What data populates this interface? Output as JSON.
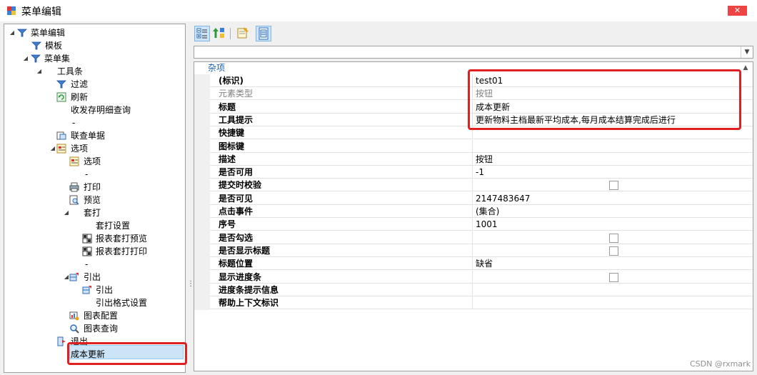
{
  "window": {
    "title": "菜单编辑"
  },
  "tree": {
    "items": [
      {
        "label": "菜单编辑",
        "icon": "filter-icon",
        "arrow": "▲"
      },
      {
        "label": "模板",
        "icon": "filter-icon",
        "arrow": ""
      },
      {
        "label": "菜单集",
        "icon": "filter-icon",
        "arrow": "▲"
      },
      {
        "label": "工具条",
        "icon": "",
        "arrow": "▲"
      },
      {
        "label": "过滤",
        "icon": "filter-icon",
        "arrow": ""
      },
      {
        "label": "刷新",
        "icon": "refresh-icon",
        "arrow": ""
      },
      {
        "label": "收发存明细查询",
        "icon": "",
        "arrow": ""
      },
      {
        "label": "-",
        "icon": "",
        "arrow": ""
      },
      {
        "label": "联查单据",
        "icon": "link-doc-icon",
        "arrow": ""
      },
      {
        "label": "选项",
        "icon": "options-icon",
        "arrow": "▲"
      },
      {
        "label": "选项",
        "icon": "options-icon",
        "arrow": ""
      },
      {
        "label": "-",
        "icon": "",
        "arrow": ""
      },
      {
        "label": "打印",
        "icon": "printer-icon",
        "arrow": ""
      },
      {
        "label": "预览",
        "icon": "preview-icon",
        "arrow": ""
      },
      {
        "label": "套打",
        "icon": "",
        "arrow": "▲"
      },
      {
        "label": "套打设置",
        "icon": "",
        "arrow": ""
      },
      {
        "label": "报表套打预览",
        "icon": "grid-report-icon",
        "arrow": ""
      },
      {
        "label": "报表套打打印",
        "icon": "grid-report-icon",
        "arrow": ""
      },
      {
        "label": "-",
        "icon": "",
        "arrow": ""
      },
      {
        "label": "引出",
        "icon": "export-icon",
        "arrow": "▲"
      },
      {
        "label": "引出",
        "icon": "export-icon",
        "arrow": ""
      },
      {
        "label": "引出格式设置",
        "icon": "",
        "arrow": ""
      },
      {
        "label": "图表配置",
        "icon": "chart-config-icon",
        "arrow": ""
      },
      {
        "label": "图表查询",
        "icon": "magnifier-icon",
        "arrow": ""
      },
      {
        "label": "退出",
        "icon": "exit-icon",
        "arrow": ""
      },
      {
        "label": "成本更新",
        "icon": "",
        "arrow": ""
      }
    ]
  },
  "toolbar": {
    "buttons": [
      {
        "name": "categorized-button",
        "icon": "categorized-icon"
      },
      {
        "name": "alphabetical-button",
        "icon": "sort-az-icon"
      },
      {
        "name": "property-pages-button",
        "icon": "property-pages-icon"
      },
      {
        "name": "properties-button",
        "icon": "properties-icon"
      }
    ]
  },
  "selector": {
    "value": ""
  },
  "grid": {
    "category": "杂项",
    "rows": [
      {
        "name": "(标识)",
        "value": "test01",
        "type": "text",
        "disabled": false
      },
      {
        "name": "元素类型",
        "value": "按钮",
        "type": "text",
        "disabled": true
      },
      {
        "name": "标题",
        "value": "成本更新",
        "type": "text",
        "disabled": false
      },
      {
        "name": "工具提示",
        "value": "更新物料主档最新平均成本,每月成本结算完成后进行",
        "type": "text",
        "disabled": false
      },
      {
        "name": "快捷键",
        "value": "",
        "type": "text",
        "disabled": false
      },
      {
        "name": "图标键",
        "value": "",
        "type": "text",
        "disabled": false
      },
      {
        "name": "描述",
        "value": "按钮",
        "type": "text",
        "disabled": false
      },
      {
        "name": "是否可用",
        "value": "-1",
        "type": "text",
        "disabled": false
      },
      {
        "name": "提交时校验",
        "value": "",
        "type": "check",
        "disabled": false
      },
      {
        "name": "是否可见",
        "value": "2147483647",
        "type": "text",
        "disabled": false
      },
      {
        "name": "点击事件",
        "value": "(集合)",
        "type": "text",
        "disabled": false
      },
      {
        "name": "序号",
        "value": "1001",
        "type": "text",
        "disabled": false
      },
      {
        "name": "是否勾选",
        "value": "",
        "type": "check",
        "disabled": false
      },
      {
        "name": "是否显示标题",
        "value": "",
        "type": "check",
        "disabled": false
      },
      {
        "name": "标题位置",
        "value": "缺省",
        "type": "text",
        "disabled": false
      },
      {
        "name": "显示进度条",
        "value": "",
        "type": "check",
        "disabled": false
      },
      {
        "name": "进度条提示信息",
        "value": "",
        "type": "text",
        "disabled": false
      },
      {
        "name": "帮助上下文标识",
        "value": "",
        "type": "text",
        "disabled": false
      }
    ]
  },
  "watermark": "CSDN @rxmark",
  "colors": {
    "highlight": "#e02020",
    "selection": "#cce4f7",
    "category": "#2060b0"
  }
}
